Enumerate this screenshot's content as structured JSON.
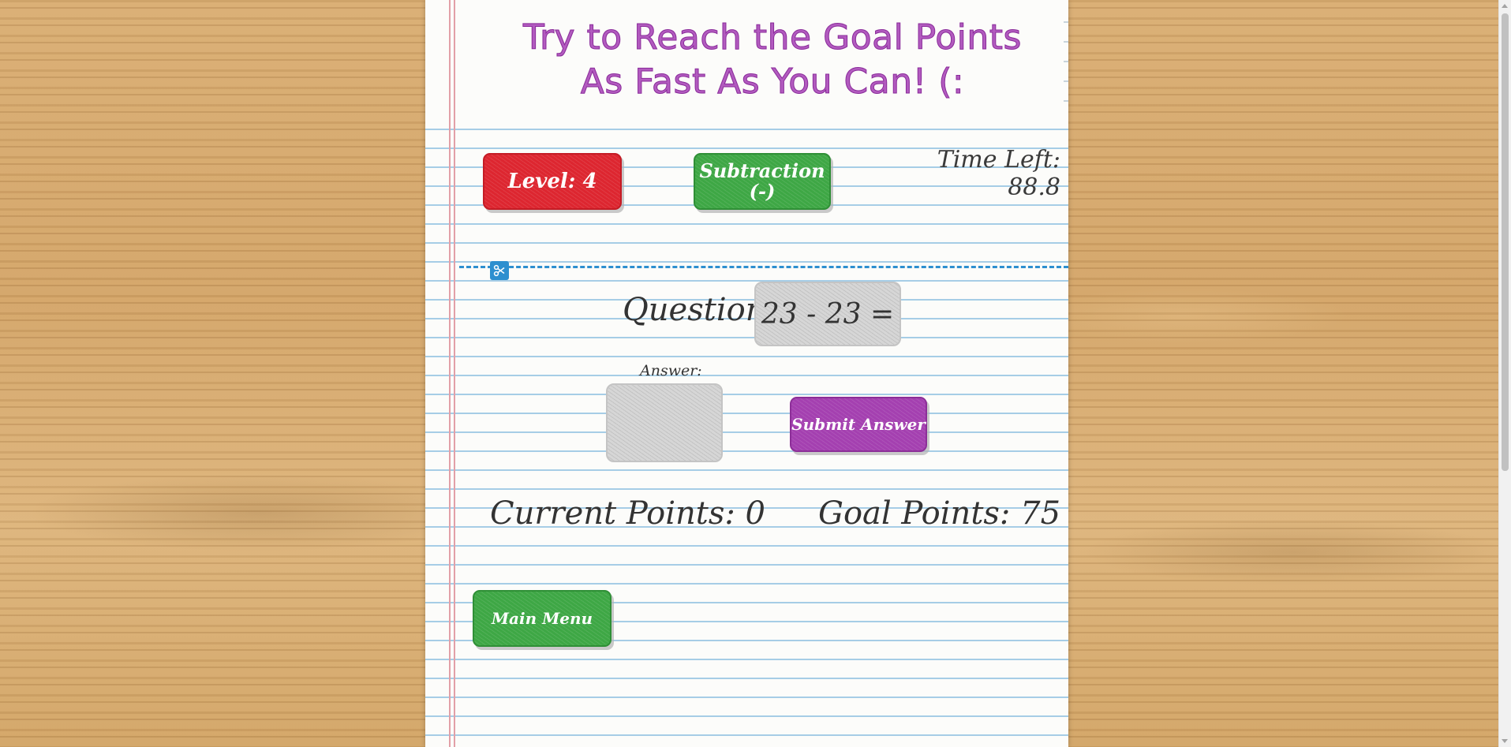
{
  "header": {
    "title_line1": "Try to Reach the Goal Points",
    "title_line2": "As Fast As You Can! (:"
  },
  "controls": {
    "level_label": "Level: 4",
    "mode_label_line1": "Subtraction",
    "mode_label_line2": "(-)",
    "time_left": "Time Left: 88.8"
  },
  "question": {
    "label": "Question:",
    "expression": "23 - 23 ="
  },
  "answer": {
    "label": "Answer:",
    "value": "",
    "placeholder": "",
    "submit_label": "Submit Answer"
  },
  "score": {
    "current": "Current Points: 0",
    "goal": "Goal Points: 75"
  },
  "footer": {
    "main_menu_label": "Main Menu"
  },
  "icons": {
    "cut": "scissors-icon"
  },
  "colors": {
    "title": "#b25bbf",
    "level_button": "#dd2630",
    "mode_button": "#3ea745",
    "submit_button": "#a440b0",
    "menu_button": "#3ea745",
    "cut_line": "#2d8fcf"
  }
}
